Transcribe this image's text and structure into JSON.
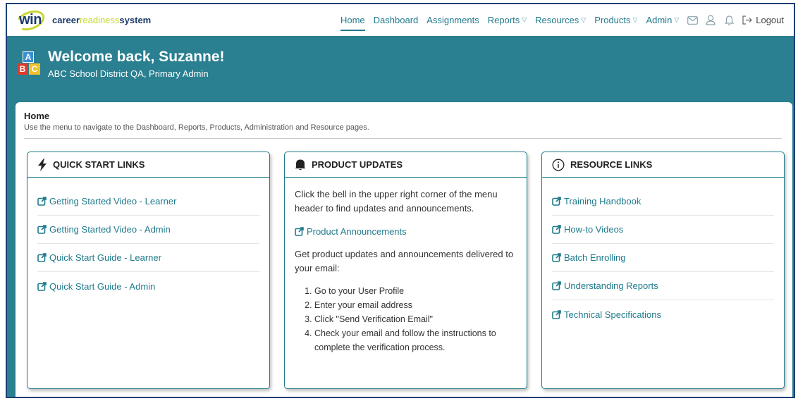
{
  "header": {
    "logo_text": "win",
    "brand_bold": "career",
    "brand_light": "readiness",
    "brand_tail": "system",
    "nav": [
      {
        "label": "Home"
      },
      {
        "label": "Dashboard"
      },
      {
        "label": "Assignments"
      },
      {
        "label": "Reports"
      },
      {
        "label": "Resources"
      },
      {
        "label": "Products"
      },
      {
        "label": "Admin"
      }
    ],
    "logout_label": "Logout"
  },
  "banner": {
    "title": "Welcome back, Suzanne!",
    "subtitle": "ABC School District QA, Primary Admin",
    "blocks": [
      "A",
      "B",
      "C"
    ]
  },
  "main": {
    "title": "Home",
    "description": "Use the menu to navigate to the Dashboard, Reports, Products, Administration and Resource pages."
  },
  "quick_start": {
    "title": "QUICK START LINKS",
    "links": [
      "Getting Started Video - Learner",
      "Getting Started Video - Admin",
      "Quick Start Guide - Learner",
      "Quick Start Guide - Admin"
    ]
  },
  "product_updates": {
    "title": "PRODUCT UPDATES",
    "intro": "Click the bell in the upper right corner of the menu header to find updates and announcements.",
    "link": "Product Announcements",
    "email_text": "Get product updates and announcements delivered to your email:",
    "steps": [
      "Go to your User Profile",
      "Enter your email address",
      "Click \"Send Verification Email\"",
      "Check your email and follow the instructions to complete the verification process."
    ]
  },
  "resource_links": {
    "title": "RESOURCE LINKS",
    "links": [
      "Training Handbook",
      "How-to Videos",
      "Batch Enrolling",
      "Understanding Reports",
      "Technical Specifications"
    ]
  },
  "colors": {
    "teal": "#2a7f90",
    "link": "#1f7a8c",
    "navy": "#1b3a6b",
    "lime": "#c8d630"
  }
}
